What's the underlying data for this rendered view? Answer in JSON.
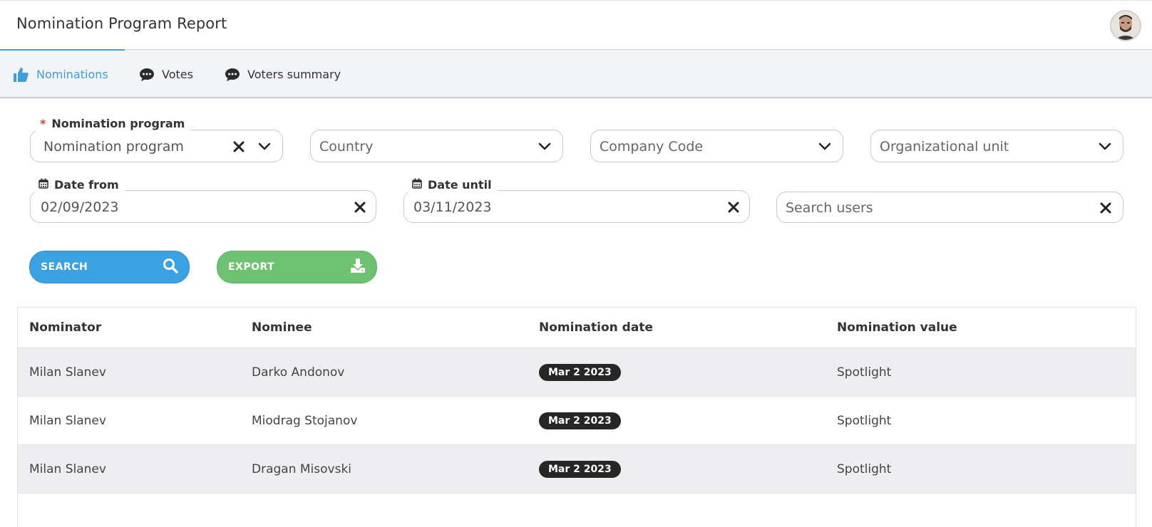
{
  "header": {
    "title": "Nomination Program Report"
  },
  "tabs": [
    {
      "label": "Nominations",
      "icon": "thumbs-up-icon"
    },
    {
      "label": "Votes",
      "icon": "comment-icon"
    },
    {
      "label": "Voters summary",
      "icon": "comment-icon"
    }
  ],
  "filters": {
    "nomination_program": {
      "legend": "Nomination program",
      "required_mark": "*",
      "value": "Nomination program"
    },
    "country": {
      "placeholder": "Country"
    },
    "company_code": {
      "placeholder": "Company Code"
    },
    "org_unit": {
      "placeholder": "Organizational unit"
    },
    "date_from": {
      "legend": "Date from",
      "value": "02/09/2023"
    },
    "date_until": {
      "legend": "Date until",
      "value": "03/11/2023"
    },
    "search_users": {
      "placeholder": "Search users"
    }
  },
  "actions": {
    "search_label": "SEARCH",
    "export_label": "EXPORT"
  },
  "table": {
    "columns": [
      "Nominator",
      "Nominee",
      "Nomination date",
      "Nomination value"
    ],
    "rows": [
      {
        "nominator": "Milan Slanev",
        "nominee": "Darko Andonov",
        "date": "Mar 2 2023",
        "value": "Spotlight"
      },
      {
        "nominator": "Milan Slanev",
        "nominee": "Miodrag Stojanov",
        "date": "Mar 2 2023",
        "value": "Spotlight"
      },
      {
        "nominator": "Milan Slanev",
        "nominee": "Dragan Misovski",
        "date": "Mar 2 2023",
        "value": "Spotlight"
      }
    ]
  },
  "colors": {
    "accent": "#3d9fdb",
    "search_button": "#3aa1e2",
    "export_button": "#6cc270",
    "badge": "#262626",
    "required": "#e0433a"
  }
}
